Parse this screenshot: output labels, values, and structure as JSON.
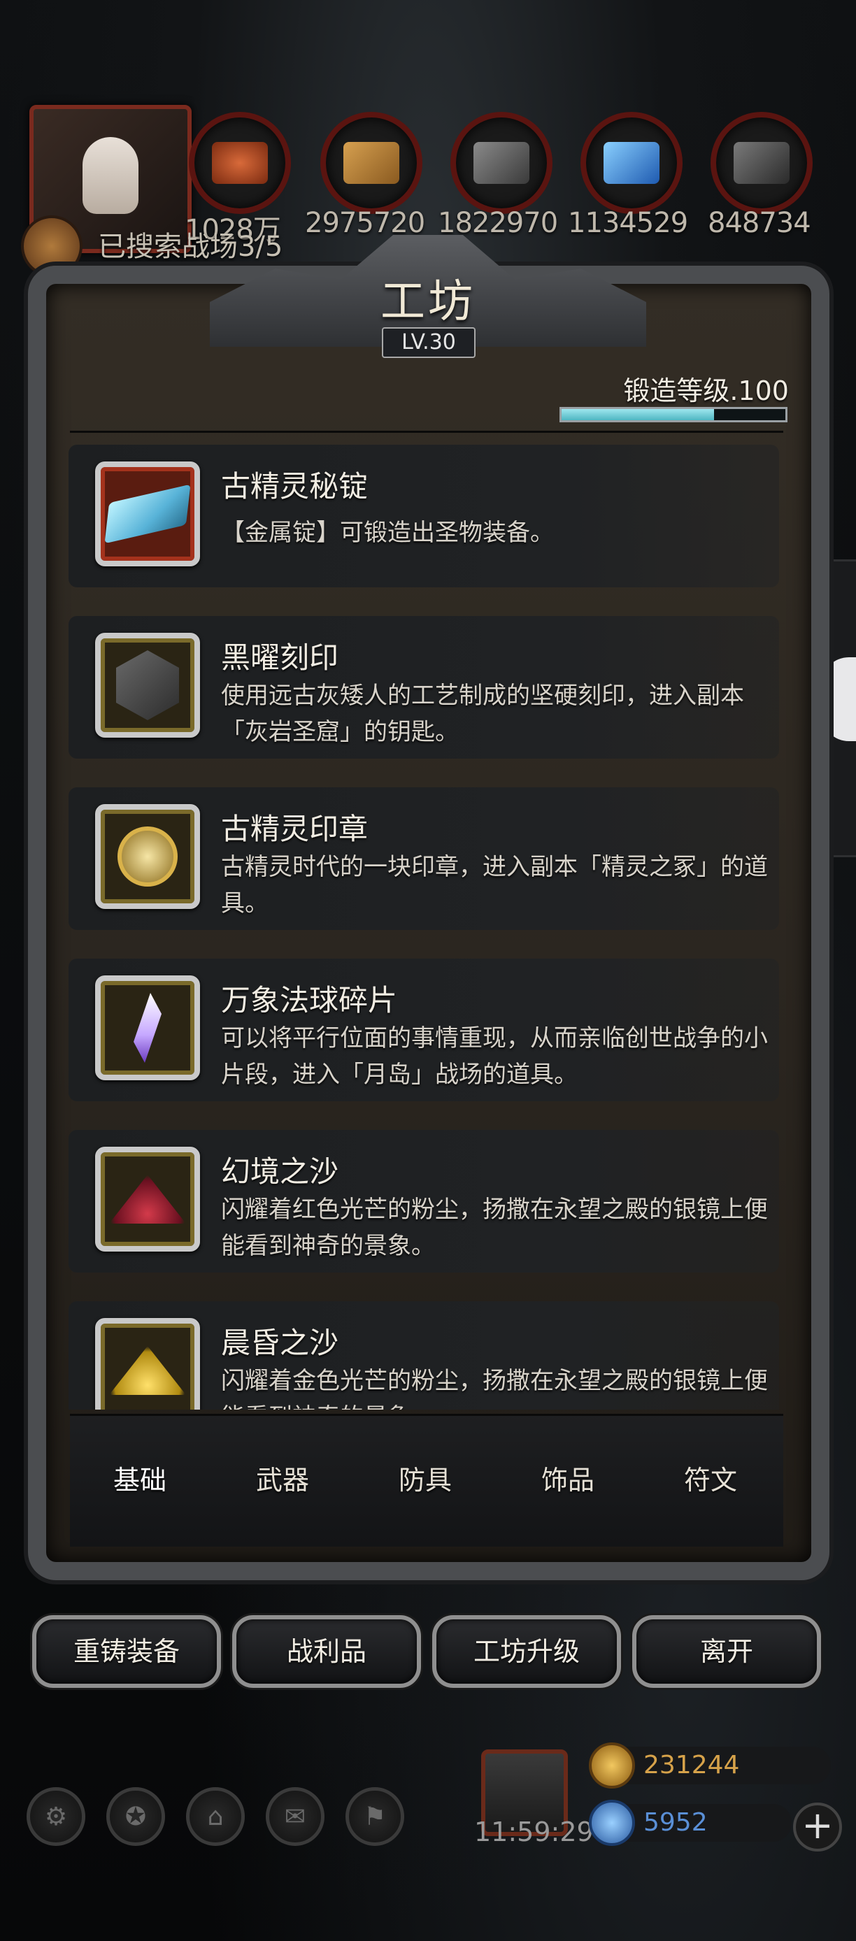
{
  "hud": {
    "resources": [
      "1028万",
      "2975720",
      "1822970",
      "1134529",
      "848734"
    ],
    "explore_text": "已搜索战场3/5"
  },
  "panel": {
    "title": "工坊",
    "level": "LV.30",
    "forge_level_label": "锻造等级.100",
    "forge_progress": 0.68
  },
  "items": [
    {
      "name": "古精灵秘锭",
      "desc": "【金属锭】可锻造出圣物装备。",
      "icon": "ingot-icon",
      "frame": "red"
    },
    {
      "name": "黑曜刻印",
      "desc": "使用远古灰矮人的工艺制成的坚硬刻印，进入副本「灰岩圣窟」的钥匙。",
      "icon": "obsidian-seal-icon",
      "frame": "gold"
    },
    {
      "name": "古精灵印章",
      "desc": "古精灵时代的一块印章，进入副本「精灵之冢」的道具。",
      "icon": "elf-emblem-icon",
      "frame": "gold"
    },
    {
      "name": "万象法球碎片",
      "desc": "可以将平行位面的事情重现，从而亲临创世战争的小片段，进入「月岛」战场的道具。",
      "icon": "orb-shard-icon",
      "frame": "gold"
    },
    {
      "name": "幻境之沙",
      "desc": "闪耀着红色光芒的粉尘，扬撒在永望之殿的银镜上便能看到神奇的景象。",
      "icon": "red-sand-icon",
      "frame": "gold"
    },
    {
      "name": "晨昏之沙",
      "desc": "闪耀着金色光芒的粉尘，扬撒在永望之殿的银镜上便能看到神奇的景象。",
      "icon": "gold-sand-icon",
      "frame": "gold"
    }
  ],
  "tabs": [
    "基础",
    "武器",
    "防具",
    "饰品",
    "符文"
  ],
  "active_tab": "基础",
  "buttons": [
    "重铸装备",
    "战利品",
    "工坊升级",
    "离开"
  ],
  "footer": {
    "timer": "11:59:29",
    "gold": "231244",
    "gems": "5952",
    "plus": "+"
  },
  "colors": {
    "panel_border": "#4b4d50",
    "gold_text": "#d6a24a",
    "gem_text": "#5a8fd6",
    "progress_fill": "#7fd3dc"
  }
}
